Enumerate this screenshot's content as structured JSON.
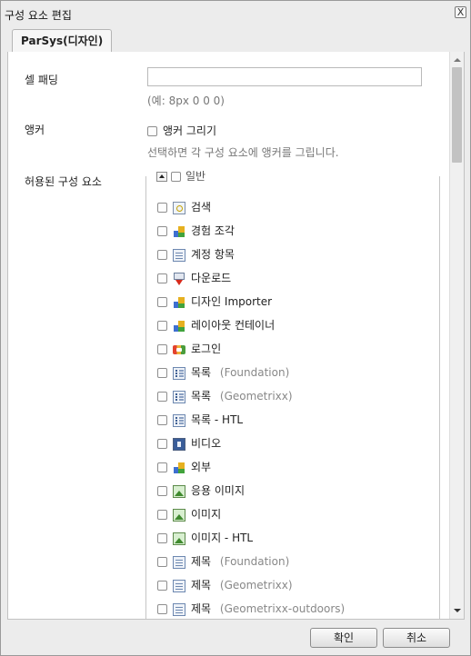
{
  "dialog": {
    "title": "구성 요소 편집",
    "close_label": "X"
  },
  "tabs": [
    {
      "label": "ParSys(디자인)",
      "active": true
    }
  ],
  "form": {
    "cell_padding": {
      "label": "셀 패딩",
      "value": "",
      "hint": "(예: 8px 0 0 0)"
    },
    "anchor": {
      "label": "앵커",
      "checkbox_label": "앵커 그리기",
      "checked": false,
      "hint": "선택하면 각 구성 요소에 앵커를 그립니다."
    },
    "allowed_components": {
      "label": "허용된 구성 요소",
      "group": {
        "name": "일반",
        "checked": false,
        "expanded": true
      },
      "items": [
        {
          "label": "검색",
          "note": "",
          "icon": "search-icon",
          "checked": false
        },
        {
          "label": "경험 조각",
          "note": "",
          "icon": "blocks-icon",
          "checked": false
        },
        {
          "label": "계정 항목",
          "note": "",
          "icon": "document-icon",
          "checked": false
        },
        {
          "label": "다운로드",
          "note": "",
          "icon": "download-icon",
          "checked": false
        },
        {
          "label": "디자인 Importer",
          "note": "",
          "icon": "blocks-icon",
          "checked": false
        },
        {
          "label": "레이아웃 컨테이너",
          "note": "",
          "icon": "blocks-icon",
          "checked": false
        },
        {
          "label": "로그인",
          "note": "",
          "icon": "login-icon",
          "checked": false
        },
        {
          "label": "목록",
          "note": "(Foundation)",
          "icon": "list-icon",
          "checked": false
        },
        {
          "label": "목록",
          "note": "(Geometrixx)",
          "icon": "list-icon",
          "checked": false
        },
        {
          "label": "목록 - HTL",
          "note": "",
          "icon": "list-icon",
          "checked": false
        },
        {
          "label": "비디오",
          "note": "",
          "icon": "video-icon",
          "checked": false
        },
        {
          "label": "외부",
          "note": "",
          "icon": "blocks-icon",
          "checked": false
        },
        {
          "label": "응용 이미지",
          "note": "",
          "icon": "image-icon",
          "checked": false
        },
        {
          "label": "이미지",
          "note": "",
          "icon": "image-icon",
          "checked": false
        },
        {
          "label": "이미지 - HTL",
          "note": "",
          "icon": "image-icon",
          "checked": false
        },
        {
          "label": "제목",
          "note": "(Foundation)",
          "icon": "document-icon",
          "checked": false
        },
        {
          "label": "제목",
          "note": "(Geometrixx)",
          "icon": "document-icon",
          "checked": false
        },
        {
          "label": "제목",
          "note": "(Geometrixx-outdoors)",
          "icon": "document-icon",
          "checked": false
        }
      ]
    }
  },
  "footer": {
    "ok_label": "확인",
    "cancel_label": "취소"
  }
}
